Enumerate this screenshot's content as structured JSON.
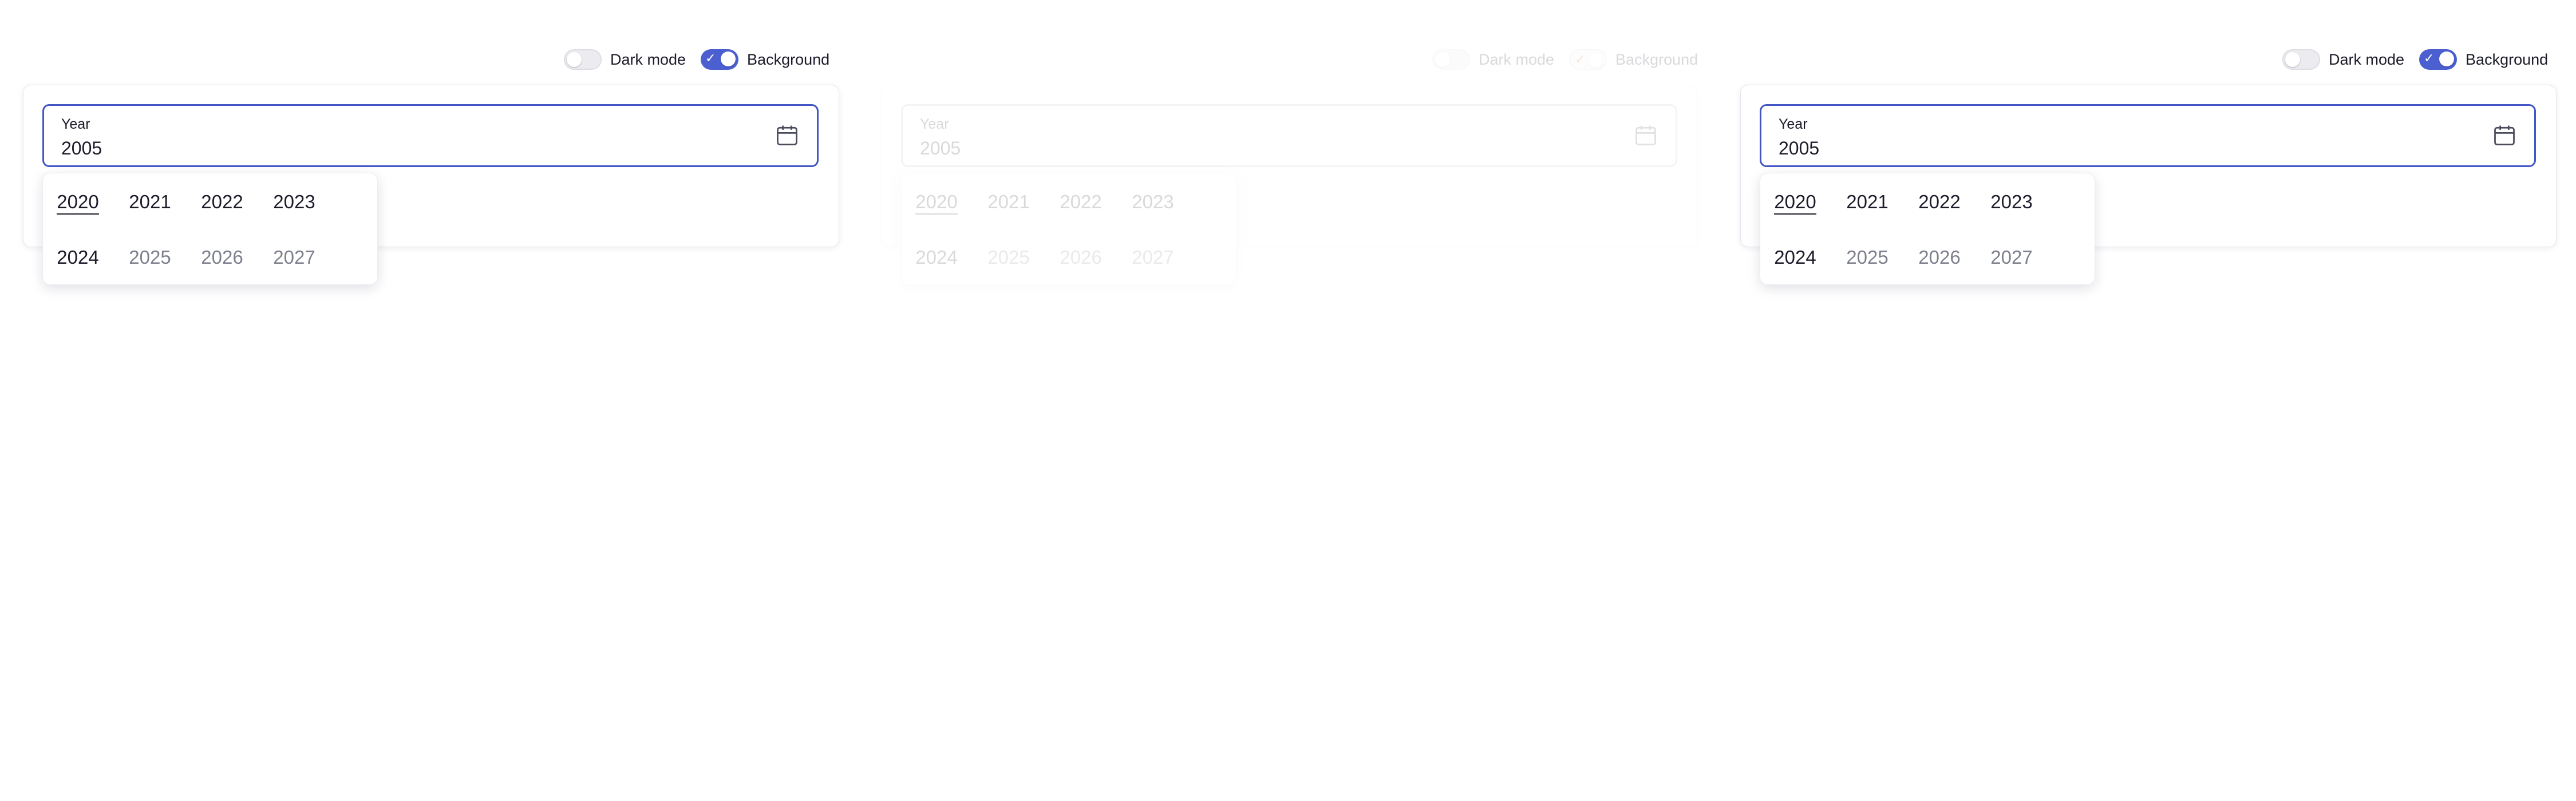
{
  "panels": [
    {
      "dark_mode_label": "Dark mode",
      "background_label": "Background",
      "dark_mode_on": false,
      "background_on": true,
      "field_label": "Year",
      "field_value": "2005",
      "years_row1": [
        "2020",
        "2021",
        "2022",
        "2023"
      ],
      "years_row2": [
        "2024",
        "2025",
        "2026",
        "2027"
      ],
      "selected_year": "2020"
    },
    {
      "dark_mode_label": "Dark mode",
      "background_label": "Background",
      "dark_mode_on": false,
      "background_on": true,
      "field_label": "Year",
      "field_value": "2005",
      "years_row1": [
        "2020",
        "2021",
        "2022",
        "2023"
      ],
      "years_row2": [
        "2024",
        "2025",
        "2026",
        "2027"
      ],
      "selected_year": "2020"
    },
    {
      "dark_mode_label": "Dark mode",
      "background_label": "Background",
      "dark_mode_on": false,
      "background_on": true,
      "field_label": "Year",
      "field_value": "2005",
      "years_row1": [
        "2020",
        "2021",
        "2022",
        "2023"
      ],
      "years_row2": [
        "2024",
        "2025",
        "2026",
        "2027"
      ],
      "selected_year": "2020"
    }
  ],
  "colors": {
    "accent": "#4b5fd1",
    "text": "#1c1c2b",
    "muted": "#7d7f8c",
    "checkbox_accent_faded_panel": "#e8590c"
  },
  "icons": {
    "field_icon": "calendar-icon",
    "toggle_check": "check-icon"
  }
}
